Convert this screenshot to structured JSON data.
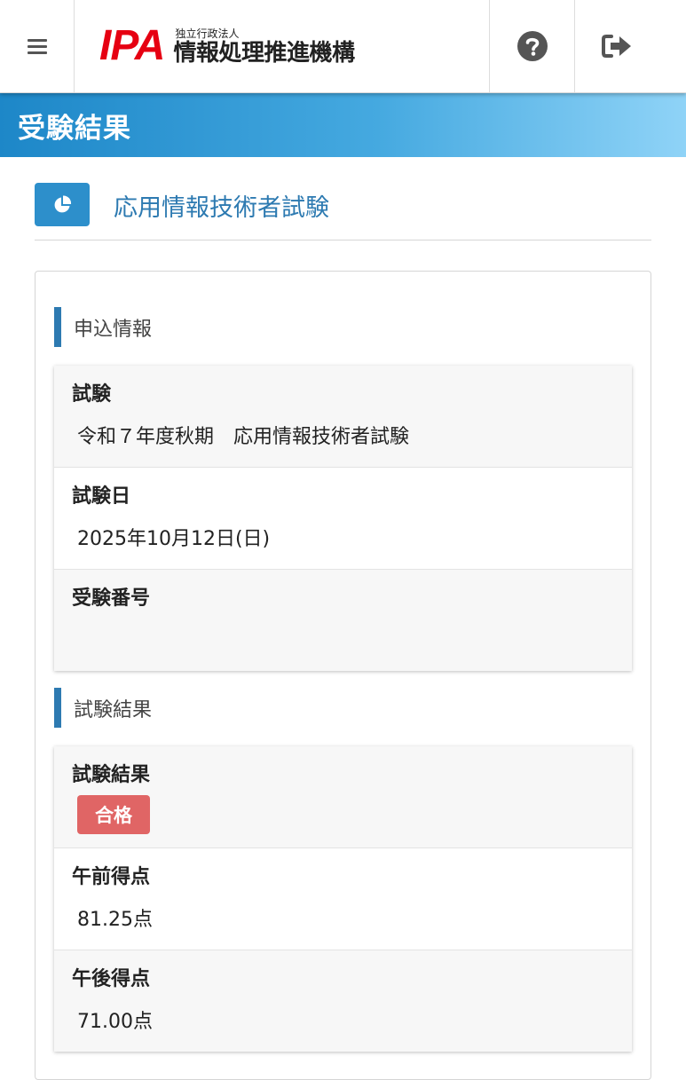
{
  "header": {
    "logo_mark": "IPA",
    "logo_small": "独立行政法人",
    "logo_big": "情報処理推進機構",
    "icons": [
      "menu-icon",
      "question-circle-icon",
      "sign-out-icon"
    ]
  },
  "banner": {
    "title": "受験結果"
  },
  "exam": {
    "name": "応用情報技術者試験",
    "icon": "pie-chart-icon"
  },
  "application": {
    "heading": "申込情報",
    "fields": [
      {
        "label": "試験",
        "value": "令和７年度秋期　応用情報技術者試験"
      },
      {
        "label": "試験日",
        "value": "2025年10月12日(日)"
      },
      {
        "label": "受験番号",
        "value": ""
      }
    ]
  },
  "result": {
    "heading": "試験結果",
    "status_label": "試験結果",
    "status_badge": "合格",
    "badge_color": "#e06565",
    "morning_label": "午前得点",
    "morning_value": "81.25点",
    "afternoon_label": "午後得点",
    "afternoon_value": "71.00点"
  },
  "colors": {
    "accent": "#2d7ab1",
    "logo_red": "#e60012",
    "banner_start": "#1d87c8",
    "banner_end": "#8fd3f7"
  }
}
